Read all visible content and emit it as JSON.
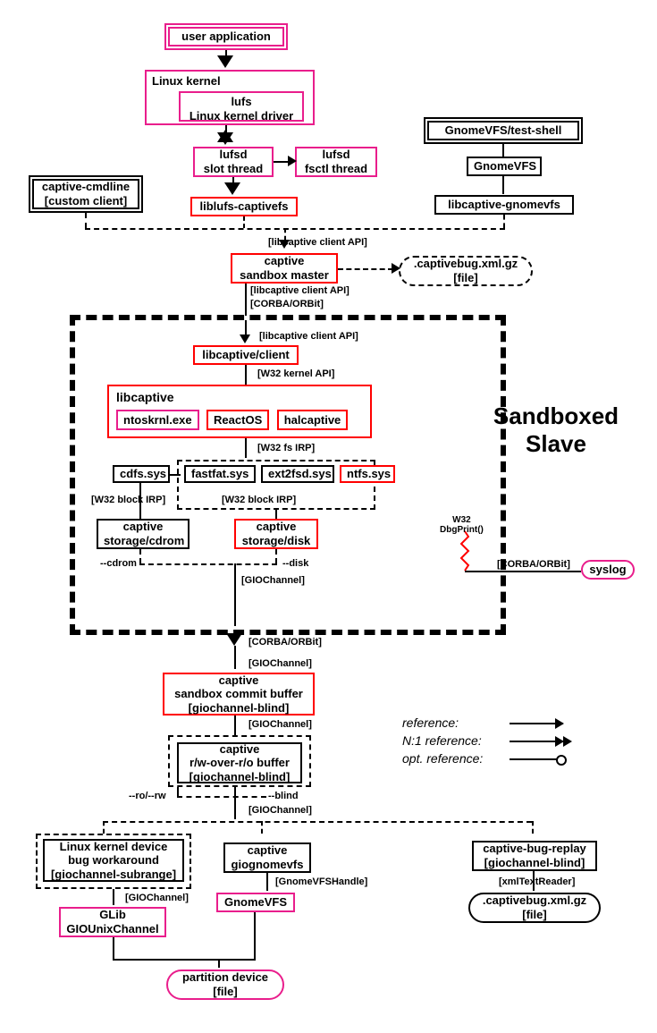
{
  "nodes": {
    "user_app": "user application",
    "linux_kernel": "Linux kernel",
    "lufs_driver": "lufs\nLinux kernel driver",
    "lufsd_slot": "lufsd\nslot thread",
    "lufsd_fsctl": "lufsd\nfsctl thread",
    "captive_cmdline": "captive-cmdline\n[custom client]",
    "liblufs": "liblufs-captivefs",
    "gnomevfs_shell": "GnomeVFS/test-shell",
    "gnomevfs": "GnomeVFS",
    "libcaptive_gnomevfs": "libcaptive-gnomevfs",
    "sandbox_master": "captive\nsandbox master",
    "captivebug_file": ".captivebug.xml.gz\n[file]",
    "libcaptive_client": "libcaptive/client",
    "libcaptive": "libcaptive",
    "ntoskrnl": "ntoskrnl.exe",
    "reactos": "ReactOS",
    "halcaptive": "halcaptive",
    "cdfs": "cdfs.sys",
    "fastfat": "fastfat.sys",
    "ext2fsd": "ext2fsd.sys",
    "ntfs": "ntfs.sys",
    "storage_cdrom": "captive\nstorage/cdrom",
    "storage_disk": "captive\nstorage/disk",
    "syslog": "syslog",
    "commit_buffer": "captive\nsandbox commit buffer\n[giochannel-blind]",
    "rw_buffer": "captive\nr/w-over-r/o buffer\n[giochannel-blind]",
    "bug_workaround": "Linux kernel device\nbug workaround\n[giochannel-subrange]",
    "giognomevfs": "captive\ngiognomevfs",
    "bug_replay": "captive-bug-replay\n[giochannel-blind]",
    "glib_unix": "GLib\nGIOUnixChannel",
    "gnomevfs2": "GnomeVFS",
    "captivebug_file2": ".captivebug.xml.gz\n[file]",
    "partition": "partition device\n[file]"
  },
  "title": "Sandboxed\nSlave",
  "edge_labels": {
    "client_api1": "[libcaptive client API]",
    "client_api2": "[libcaptive client API]",
    "client_api3": "[libcaptive client API]",
    "corba1": "[CORBA/ORBit]",
    "corba2": "[CORBA/ORBit]",
    "corba3": "[CORBA/ORBit]",
    "w32_kernel": "[W32 kernel API]",
    "w32_fs_irp": "[W32 fs IRP]",
    "w32_block_irp1": "[W32 block IRP]",
    "w32_block_irp2": "[W32 block IRP]",
    "dbgprint": "W32\nDbgPrint()",
    "giochannel1": "[GIOChannel]",
    "giochannel2": "[GIOChannel]",
    "giochannel3": "[GIOChannel]",
    "giochannel4": "[GIOChannel]",
    "giochannel5": "[GIOChannel]",
    "gnomevfshandle": "[GnomeVFSHandle]",
    "xmltextreader": "[xmlTextReader]",
    "cdrom_opt": "--cdrom",
    "disk_opt": "--disk",
    "ro_rw": "--ro/--rw",
    "blind": "--blind"
  },
  "legend": {
    "ref": "reference:",
    "n1": "N:1 reference:",
    "opt": "opt. reference:"
  }
}
